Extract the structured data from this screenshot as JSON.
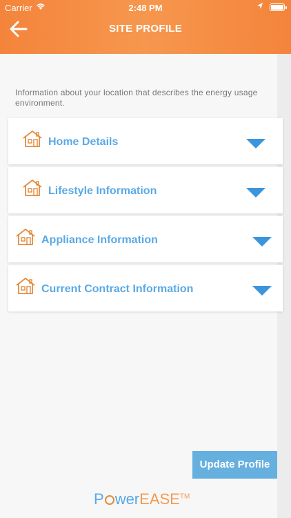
{
  "status_bar": {
    "carrier": "Carrier",
    "time": "2:48 PM"
  },
  "header": {
    "title": "SITE PROFILE",
    "back_icon": "arrow-left-icon"
  },
  "intro_text": "Information about your location that describes the energy usage environment.",
  "sections": [
    {
      "label": "Home Details",
      "icon": "house-icon",
      "toggle_icon": "chevron-down-icon"
    },
    {
      "label": "Lifestyle Information",
      "icon": "house-icon",
      "toggle_icon": "chevron-down-icon"
    },
    {
      "label": "Appliance Information",
      "icon": "house-icon",
      "toggle_icon": "chevron-down-icon"
    },
    {
      "label": "Current Contract Information",
      "icon": "house-icon",
      "toggle_icon": "chevron-down-icon"
    }
  ],
  "update_button": {
    "label": "Update Profile"
  },
  "logo": {
    "power": "Power",
    "ease": "EASE",
    "tm": "TM"
  },
  "colors": {
    "header": "#f4843b",
    "accent": "#5aa9e6",
    "button": "#66b0e0",
    "icon": "#e48a3c"
  }
}
